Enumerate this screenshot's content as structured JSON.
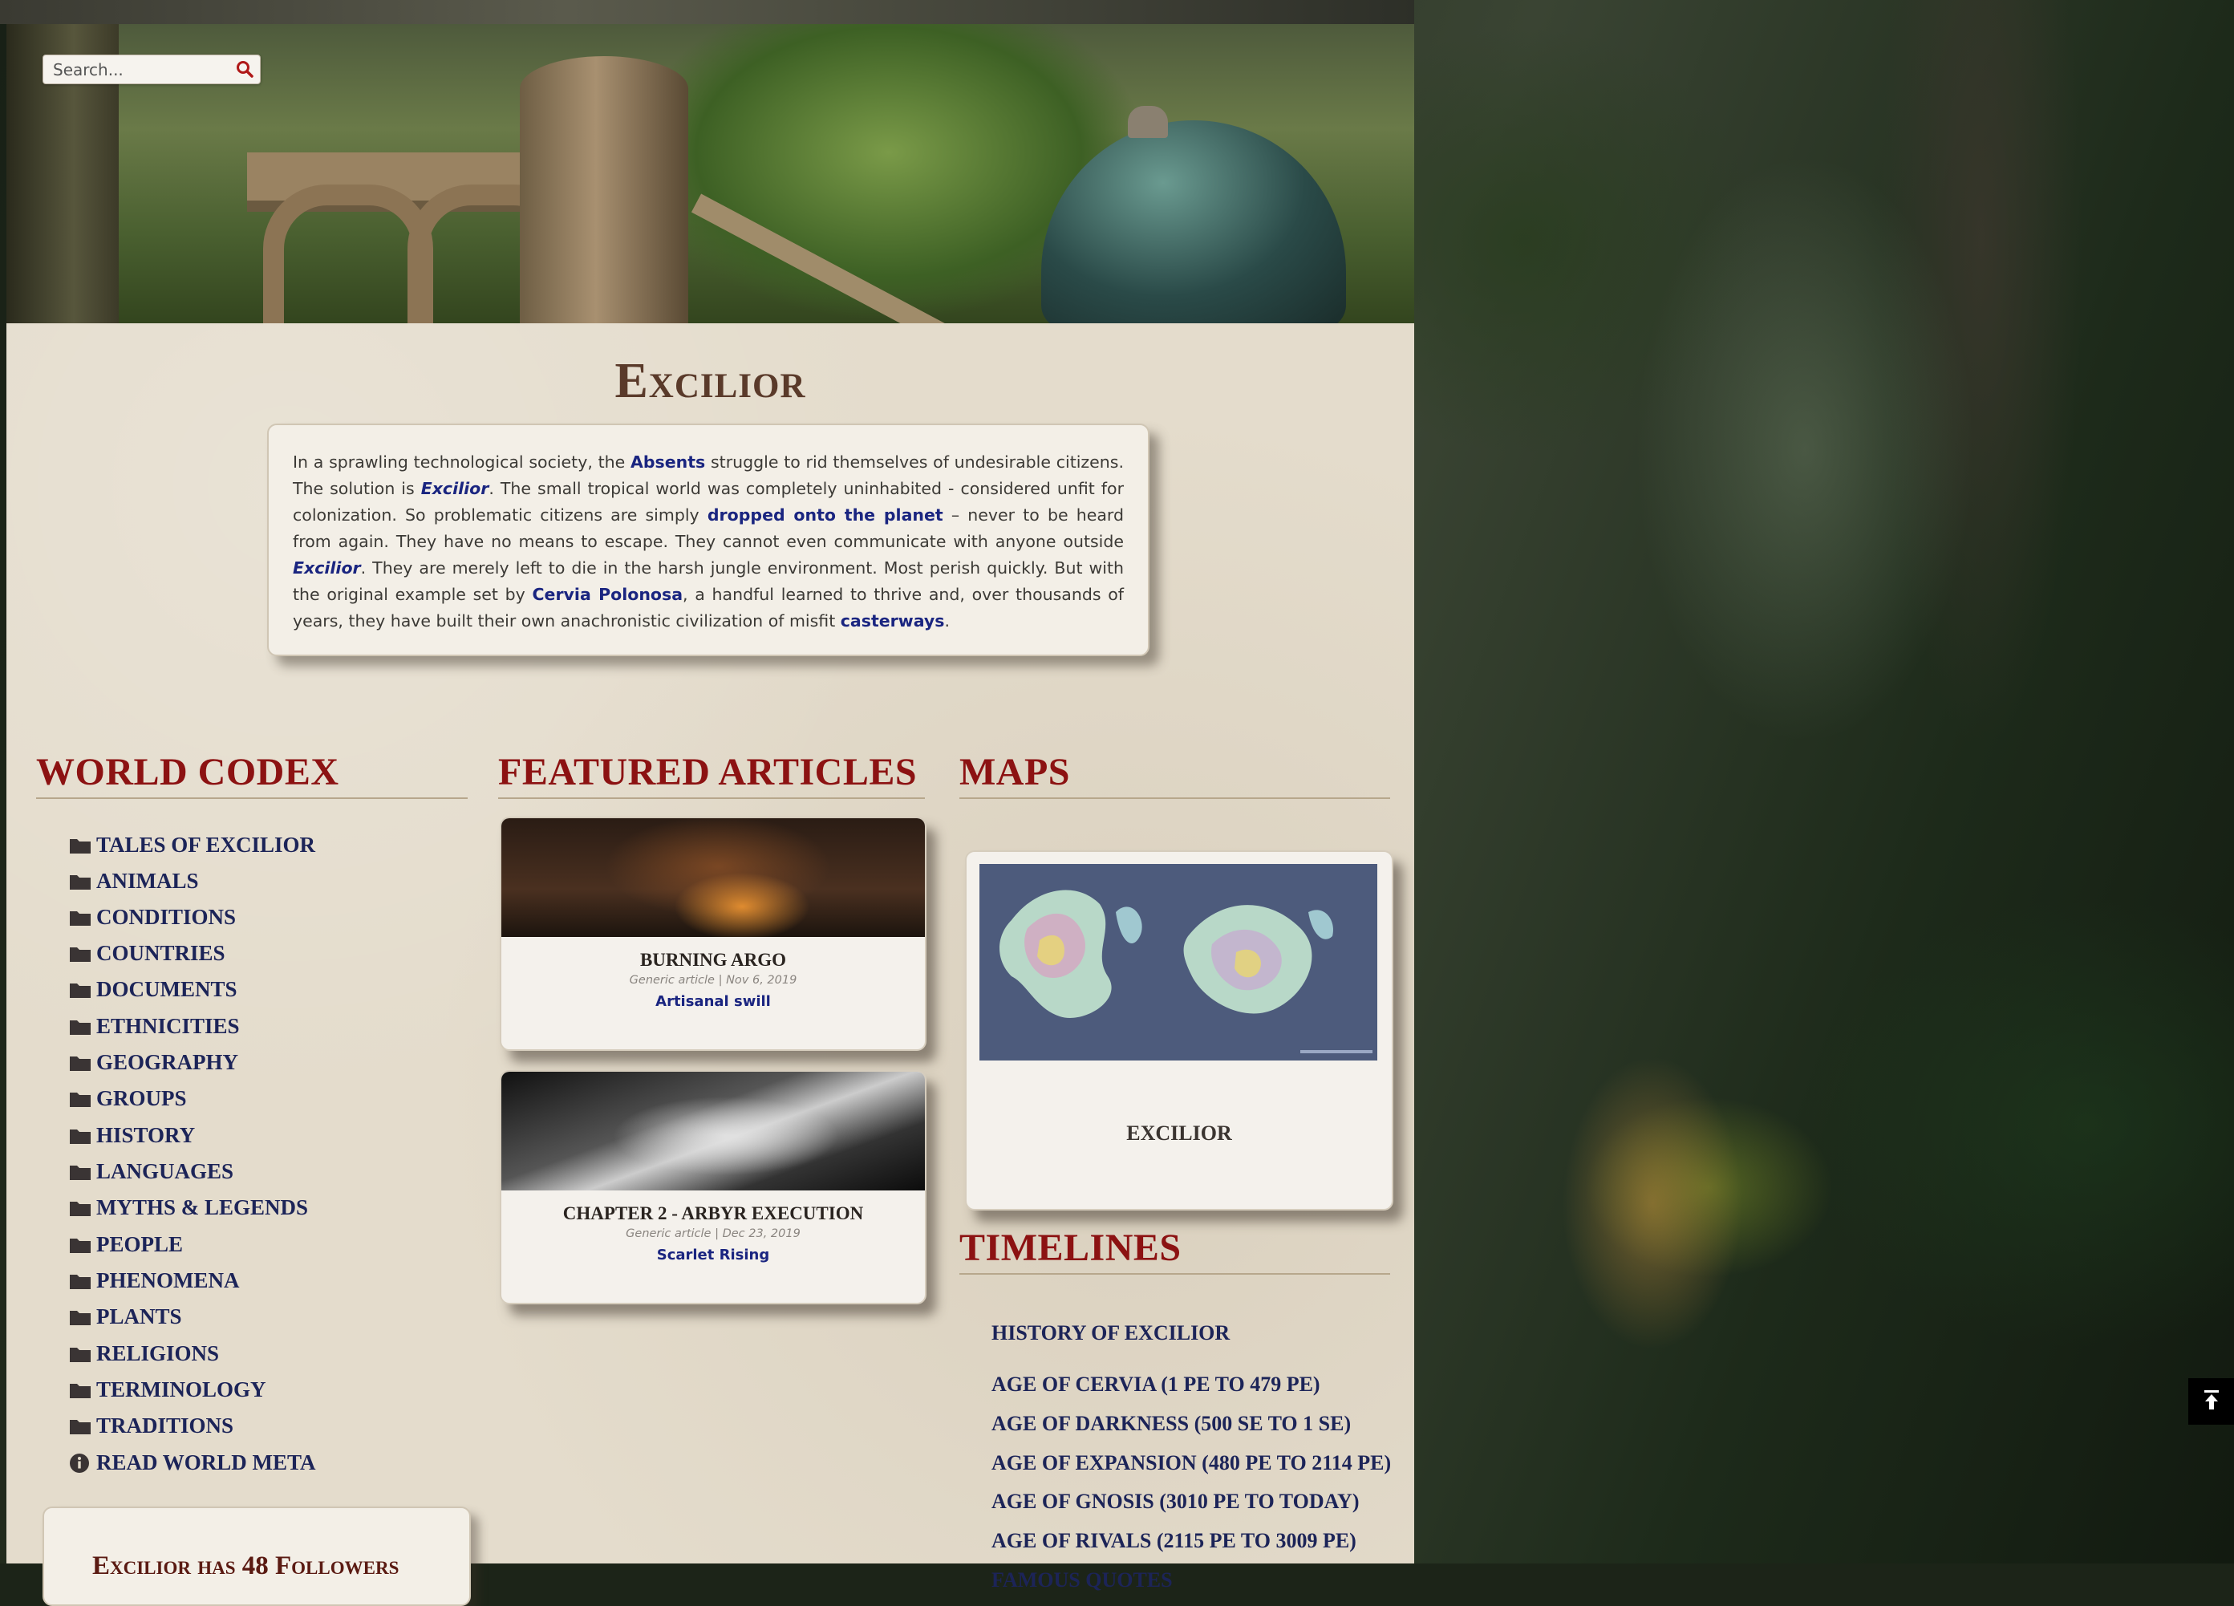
{
  "search": {
    "placeholder": "Search..."
  },
  "page": {
    "title": "Excilior"
  },
  "intro": {
    "t1": "In a sprawling technological society, the ",
    "l1": "Absents",
    "t2": " struggle to rid themselves of undesirable citizens. The solution is ",
    "l2": "Excilior",
    "t3": ". The small tropical world was completely uninhabited - considered unfit for colonization. So problematic citizens are simply ",
    "l3": "dropped onto the planet",
    "t4": " – never to be heard from again. They have no means to escape. They cannot even communicate with anyone outside ",
    "l4": "Excilior",
    "t5": ". They are merely left to die in the harsh jungle environment. Most perish quickly. But with the original example set by ",
    "l5": "Cervia Polonosa",
    "t6": ", a handful learned to thrive and, over thousands of years, they have built their own anachronistic civilization of misfit ",
    "l6": "casterways",
    "t7": "."
  },
  "codex": {
    "heading": "WORLD CODEX",
    "items": [
      {
        "label": "TALES OF EXCILIOR",
        "icon": "folder-icon"
      },
      {
        "label": "ANIMALS",
        "icon": "folder-icon"
      },
      {
        "label": "CONDITIONS",
        "icon": "folder-icon"
      },
      {
        "label": "COUNTRIES",
        "icon": "folder-icon"
      },
      {
        "label": "DOCUMENTS",
        "icon": "folder-icon"
      },
      {
        "label": "ETHNICITIES",
        "icon": "folder-icon"
      },
      {
        "label": "GEOGRAPHY",
        "icon": "folder-icon"
      },
      {
        "label": "GROUPS",
        "icon": "folder-icon"
      },
      {
        "label": "HISTORY",
        "icon": "folder-icon"
      },
      {
        "label": "LANGUAGES",
        "icon": "folder-icon"
      },
      {
        "label": "MYTHS & LEGENDS",
        "icon": "folder-icon"
      },
      {
        "label": "PEOPLE",
        "icon": "folder-icon"
      },
      {
        "label": "PHENOMENA",
        "icon": "folder-icon"
      },
      {
        "label": "PLANTS",
        "icon": "folder-icon"
      },
      {
        "label": "RELIGIONS",
        "icon": "folder-icon"
      },
      {
        "label": "TERMINOLOGY",
        "icon": "folder-icon"
      },
      {
        "label": "TRADITIONS",
        "icon": "folder-icon"
      },
      {
        "label": "READ WORLD META",
        "icon": "info-icon"
      }
    ]
  },
  "featured": {
    "heading": "FEATURED ARTICLES",
    "cards": [
      {
        "title": "BURNING ARGO",
        "meta": "Generic article | Nov 6, 2019",
        "link": "Artisanal swill"
      },
      {
        "title": "CHAPTER 2 - ARBYR EXECUTION",
        "meta": "Generic article | Dec 23, 2019",
        "link": "Scarlet Rising"
      }
    ]
  },
  "maps": {
    "heading": "MAPS",
    "label": "EXCILIOR"
  },
  "timelines": {
    "heading": "TIMELINES",
    "items": [
      "HISTORY OF EXCILIOR",
      "AGE OF CERVIA (1 PE TO 479 PE)",
      "AGE OF DARKNESS (500 SE TO 1 SE)",
      "AGE OF EXPANSION (480 PE TO 2114 PE)",
      "AGE OF GNOSIS (3010 PE TO TODAY)",
      "AGE OF RIVALS (2115 PE TO 3009 PE)",
      "FAMOUS QUOTES"
    ]
  },
  "followers": {
    "text": "Excilior has 48 Followers"
  },
  "colors": {
    "heading": "#8c1212",
    "link": "#1a2580",
    "parchment": "#e4dccc"
  }
}
